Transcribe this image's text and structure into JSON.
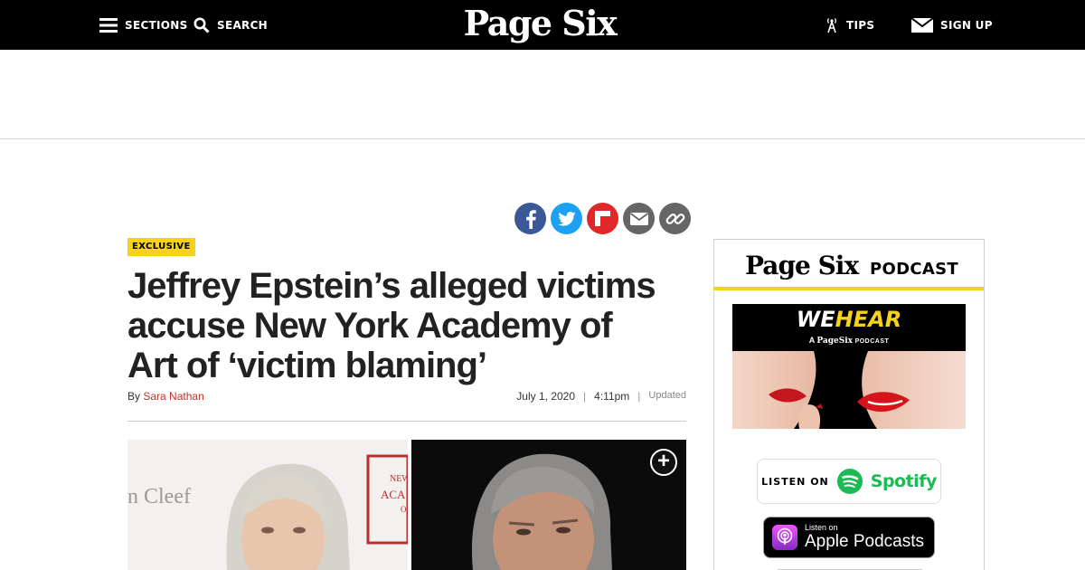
{
  "topnav": {
    "sections": "SECTIONS",
    "search": "SEARCH",
    "logo": "Page Six",
    "tips": "TIPS",
    "signup": "SIGN UP"
  },
  "share": {
    "icons": [
      "facebook-icon",
      "twitter-icon",
      "flipboard-icon",
      "email-icon",
      "link-icon"
    ],
    "colors": {
      "facebook": "#3b5998",
      "twitter": "#1da1f2",
      "flipboard": "#e12828",
      "email": "#666666",
      "link": "#666666"
    }
  },
  "article": {
    "badge": "EXCLUSIVE",
    "headline_lines": [
      "Jeffrey Epstein’s alleged victims",
      "accuse New York Academy of",
      "Art of ‘victim blaming’"
    ],
    "byline_prefix": "By",
    "author": "Sara Nathan",
    "date": "July 1, 2020",
    "time": "4:11pm",
    "sep": "|",
    "updated": "Updated",
    "photo_left_text": "n Cleef",
    "photo_left_sign": [
      "NEW",
      "ACA",
      "O"
    ],
    "expand_symbol": "+"
  },
  "sidebar": {
    "logo": "Page Six",
    "podcast_label": "PODCAST",
    "banner": {
      "title_we": "WE",
      "title_hear": "HEAR",
      "sub_a": "A",
      "sub_brand": "PageSix",
      "sub_podcast": "PODCAST"
    },
    "spotify": {
      "listen_on": "LISTEN ON",
      "brand": "Spotify"
    },
    "apple": {
      "small": "Listen on",
      "big": "Apple Podcasts"
    }
  },
  "colors": {
    "nav_bg": "#000000",
    "badge": "#f6d21a",
    "author_link": "#c4302b",
    "spotify": "#1db954",
    "rule": "#f6d21a"
  }
}
